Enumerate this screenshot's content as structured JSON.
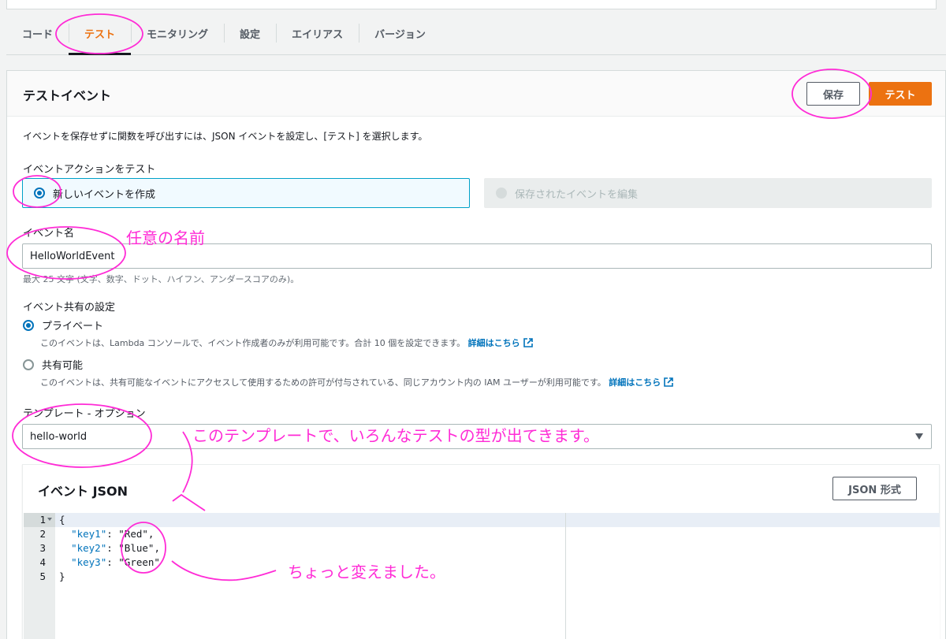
{
  "tabs": [
    {
      "label": "コード",
      "active": false
    },
    {
      "label": "テスト",
      "active": true
    },
    {
      "label": "モニタリング",
      "active": false
    },
    {
      "label": "設定",
      "active": false
    },
    {
      "label": "エイリアス",
      "active": false
    },
    {
      "label": "バージョン",
      "active": false
    }
  ],
  "panel": {
    "title": "テストイベント",
    "save_label": "保存",
    "test_label": "テスト",
    "description": "イベントを保存せずに関数を呼び出すには、JSON イベントを設定し、[テスト] を選択します。"
  },
  "event_action": {
    "label": "イベントアクションをテスト",
    "option_new": "新しいイベントを作成",
    "option_saved": "保存されたイベントを編集",
    "selected": "新しいイベントを作成"
  },
  "event_name": {
    "label": "イベント名",
    "value": "HelloWorldEvent",
    "hint": "最大 25 文字 (文字、数字、ドット、ハイフン、アンダースコアのみ)。"
  },
  "sharing": {
    "label": "イベント共有の設定",
    "private_label": "プライベート",
    "private_desc": "このイベントは、Lambda コンソールで、イベント作成者のみが利用可能です。合計 10 個を設定できます。",
    "shared_label": "共有可能",
    "shared_desc": "このイベントは、共有可能なイベントにアクセスして使用するための許可が付与されている、同じアカウント内の IAM ユーザーが利用可能です。",
    "learn_more": "詳細はこちら",
    "selected": "プライベート"
  },
  "template": {
    "label": "テンプレート - オプション",
    "value": "hello-world"
  },
  "event_json": {
    "title": "イベント JSON",
    "format_label": "JSON 形式",
    "line_numbers": [
      "1",
      "2",
      "3",
      "4",
      "5"
    ],
    "lines": [
      {
        "open": "{"
      },
      {
        "key": "\"key1\"",
        "value": "\"Red\"",
        "comma": ","
      },
      {
        "key": "\"key2\"",
        "value": "\"Blue\"",
        "comma": ","
      },
      {
        "key": "\"key3\"",
        "value": "\"Green\"",
        "comma": ""
      },
      {
        "close": "}"
      }
    ]
  },
  "annotations": {
    "name_note": "任意の名前",
    "template_note": "このテンプレートで、いろんなテストの型が出てきます。",
    "json_note": "ちょっと変えました。"
  },
  "colors": {
    "accent": "#ec7211",
    "link": "#0073bb",
    "annotation": "#ff2bd6"
  }
}
